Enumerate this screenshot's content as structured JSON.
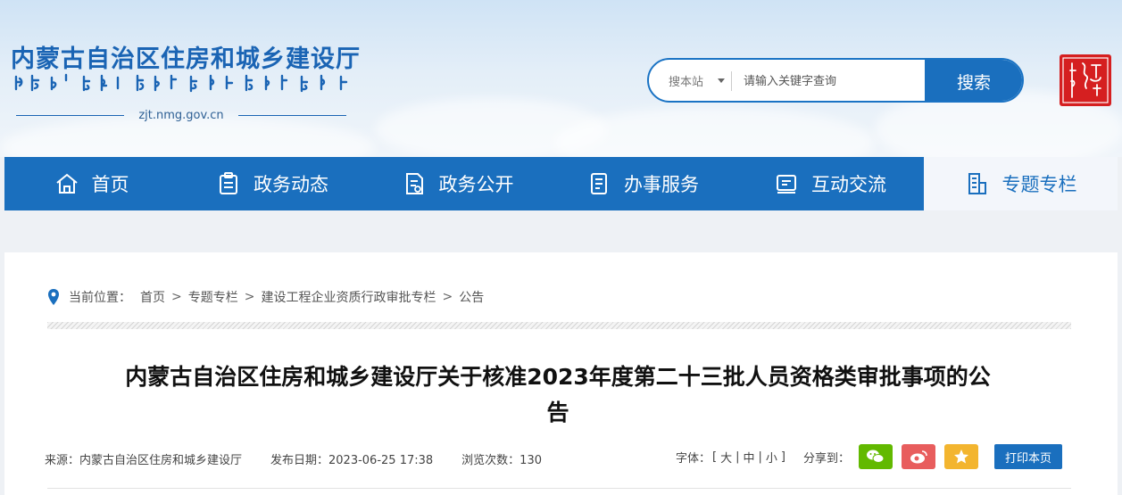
{
  "header": {
    "site_name": "内蒙古自治区住房和城乡建设厅",
    "domain": "zjt.nmg.gov.cn",
    "seal_text": "内蒙古"
  },
  "search": {
    "scope_label": "搜本站",
    "placeholder": "请输入关键字查询",
    "button_label": "搜索"
  },
  "nav": {
    "items": [
      {
        "label": "首页",
        "icon": "home-icon"
      },
      {
        "label": "政务动态",
        "icon": "clipboard-icon"
      },
      {
        "label": "政务公开",
        "icon": "document-icon"
      },
      {
        "label": "办事服务",
        "icon": "service-icon"
      },
      {
        "label": "互动交流",
        "icon": "chat-icon"
      },
      {
        "label": "专题专栏",
        "icon": "topic-icon"
      }
    ],
    "active_index": 5
  },
  "breadcrumb": {
    "prefix": "当前位置：",
    "items": [
      "首页",
      "专题专栏",
      "建设工程企业资质行政审批专栏",
      "公告"
    ],
    "separator": ">"
  },
  "article": {
    "title_line1": "内蒙古自治区住房和城乡建设厅关于核准2023年度第二十三批人员资格类审批事项的公",
    "title_line2": "告",
    "source": "来源：内蒙古自治区住房和城乡建设厅",
    "publish_date": "发布日期：2023-06-25 17:38",
    "views": "浏览次数：130"
  },
  "tools": {
    "font_label": "字体：",
    "font_open": "[",
    "font_large": "大",
    "font_medium": "中",
    "font_small": "小",
    "font_close": "]",
    "font_divider": "|",
    "share_label": "分享到：",
    "print_label": "打印本页"
  },
  "colors": {
    "brand": "#1a6fbe",
    "wechat": "#62b900",
    "weibo": "#e85d5d",
    "qzone": "#f3b52f",
    "seal": "#d51f20"
  }
}
